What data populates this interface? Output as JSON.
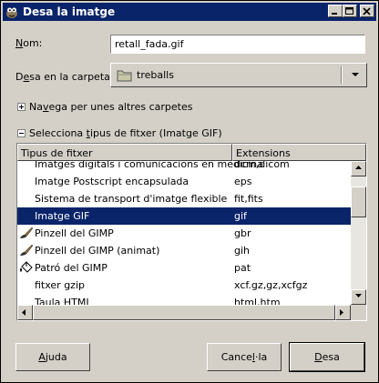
{
  "window": {
    "title": "Desa la imatge",
    "controls": [
      "minimize",
      "maximize",
      "close"
    ]
  },
  "name_field": {
    "label_pre": "",
    "label_key": "N",
    "label_post": "om:",
    "value": "retall_fada.gif"
  },
  "folder_field": {
    "label_pre": "D",
    "label_key": "e",
    "label_post": "sa en la carpeta:",
    "value": "treballs"
  },
  "browse_expander": {
    "label_pre": "Na",
    "label_key": "v",
    "label_post": "ega per unes altres carpetes",
    "state": "collapsed"
  },
  "filetype_expander": {
    "label_pre": "Selecciona ",
    "label_key": "t",
    "label_post": "ipus de fitxer (Imatge GIF)",
    "state": "expanded"
  },
  "file_types": {
    "columns": [
      "Tipus de fitxer",
      "Extensions"
    ],
    "rows": [
      {
        "name": "Imatges digitals i comunicacions en medicina",
        "ext": "dcm,dicom",
        "icon": "",
        "selected": false
      },
      {
        "name": "Imatge Postscript encapsulada",
        "ext": "eps",
        "icon": "",
        "selected": false
      },
      {
        "name": "Sistema de transport d'imatge flexible",
        "ext": "fit,fits",
        "icon": "",
        "selected": false
      },
      {
        "name": "Imatge GIF",
        "ext": "gif",
        "icon": "",
        "selected": true
      },
      {
        "name": "Pinzell del GIMP",
        "ext": "gbr",
        "icon": "brush-icon",
        "selected": false
      },
      {
        "name": "Pinzell del GIMP (animat)",
        "ext": "gih",
        "icon": "brush-icon",
        "selected": false
      },
      {
        "name": "Patró del GIMP",
        "ext": "pat",
        "icon": "bucket-icon",
        "selected": false
      },
      {
        "name": "fitxer gzip",
        "ext": "xcf.gz,gz,xcfgz",
        "icon": "",
        "selected": false
      },
      {
        "name": "Taula HTML",
        "ext": "html,htm",
        "icon": "",
        "selected": false
      }
    ]
  },
  "buttons": {
    "help": {
      "pre": "",
      "key": "A",
      "post": "juda"
    },
    "cancel": {
      "pre": "Cance",
      "key": "l",
      "post": "·la"
    },
    "save": {
      "pre": "",
      "key": "D",
      "post": "esa"
    }
  },
  "colors": {
    "titlebar": "#0a246a",
    "selection": "#0a246a",
    "face": "#d4d0c8"
  }
}
